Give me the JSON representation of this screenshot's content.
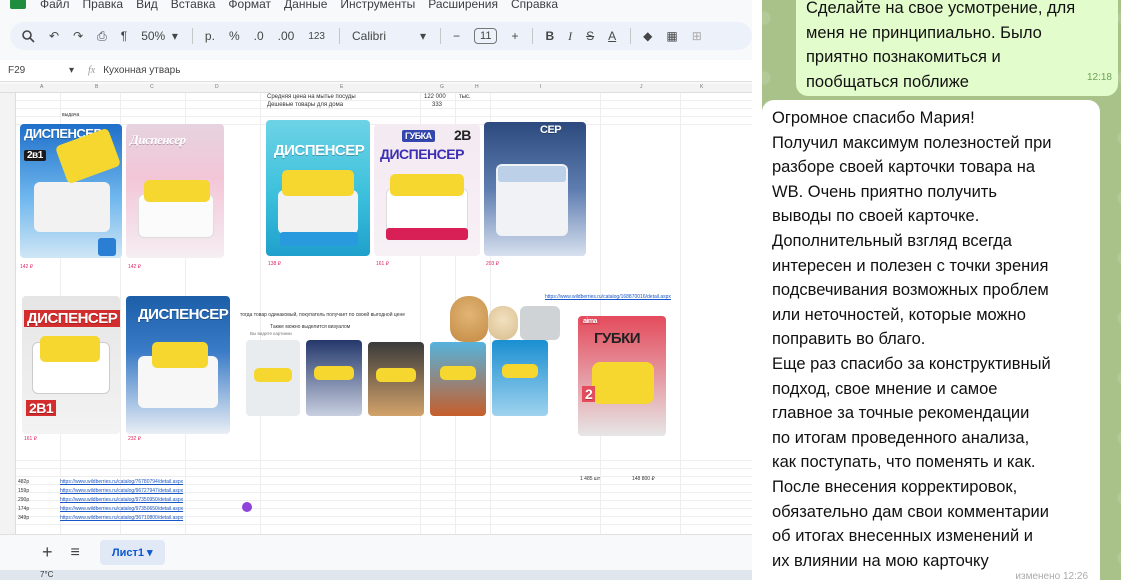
{
  "spreadsheet": {
    "menu": [
      "Файл",
      "Правка",
      "Вид",
      "Вставка",
      "Формат",
      "Данные",
      "Инструменты",
      "Расширения",
      "Справка"
    ],
    "toolbar": {
      "zoom": "50%",
      "currency_p": "р.",
      "percent": "%",
      "dec_decrease": ".0",
      "dec_increase": ".00",
      "format_123": "123",
      "font": "Calibri",
      "font_size": "11",
      "minus": "−",
      "plus": "+",
      "bold": "B",
      "italic": "I",
      "strike": "S",
      "color_a": "A"
    },
    "name_box": "F29",
    "formula": "Кухонная утварь",
    "cells": {
      "row1_label": "Средняя цена на мытье посуды",
      "row2_label": "Дешевые товары для дома",
      "row1_value": "122 000",
      "row2_value": "333",
      "row1_unit": "тыс.",
      "small_label": "выдача",
      "url_top": "https://www.wildberries.ru/catalog/168870016/detail.aspx",
      "note1": "тогда товар одинаковый, покупатель получает по своей выгодной цене",
      "note2": "Также можно выделится визуалом",
      "note3": "Вы видите картинки"
    },
    "links": [
      "https://www.wildberries.ru/catalog/76780794/detail.aspx",
      "https://www.wildberries.ru/catalog/96727947/detail.aspx",
      "https://www.wildberries.ru/catalog/97350950/detail.aspx",
      "https://www.wildberries.ru/catalog/97350650/detail.aspx",
      "https://www.wildberries.ru/catalog/36710800/detail.aspx"
    ],
    "link_labels": [
      "482р",
      "159р",
      "290р",
      "174р",
      "349р"
    ],
    "cards": {
      "c1": "ДИСПЕНСЕР",
      "c2": "Диспенсер",
      "c3": "ДИСПЕНСЕР",
      "c4": "ДИСПЕНСЕР",
      "c4_tag": "ГУБКА",
      "c4_badge": "2В",
      "c5": "СЕР",
      "c6": "ДИСПЕНСЕР",
      "c6_badge": "2В1",
      "c7": "ДИСПЕНСЕР",
      "c8": "ГУБКИ",
      "c8_brand": "aima",
      "c8_num": "2",
      "c1_badge": "2в1"
    },
    "prices": [
      "142 ₽",
      "142 ₽",
      "138 ₽",
      "161 ₽",
      "203 ₽",
      "161 ₽",
      "232 ₽"
    ],
    "bottom_prices": [
      "1 485 шт",
      "148 800 ₽"
    ],
    "sheet_tab": "Лист1",
    "taskbar_temp": "7°C"
  },
  "chat": {
    "out_message_lines": [
      "Сделайте на свое усмотрение, для",
      "меня не принципиально. Было",
      "приятно познакомиться и",
      "пообщаться поближе"
    ],
    "out_time": "12:18",
    "in_message_lines": [
      "Огромное спасибо Мария!",
      "Получил максимум полезностей при",
      "разборе своей карточки товара на",
      "WB. Очень  приятно получить",
      "выводы по своей карточке.",
      "Дополнительный взгляд всегда",
      "интересен и полезен с точки зрения",
      "подсвечивания возможных проблем",
      "или неточностей, которые можно",
      "поправить во благо.",
      "Еще раз спасибо за конструктивный",
      "подход, свое мнение и самое",
      "главное за  точные рекомендации",
      "по итогам проведенного анализа,",
      "как поступать, что поменять и как.",
      "После внесения корректировок,",
      "обязательно дам свои комментарии",
      "об итогах внесенных изменений и",
      "их влиянии на мою карточку"
    ],
    "in_time": "изменено 12:26"
  }
}
